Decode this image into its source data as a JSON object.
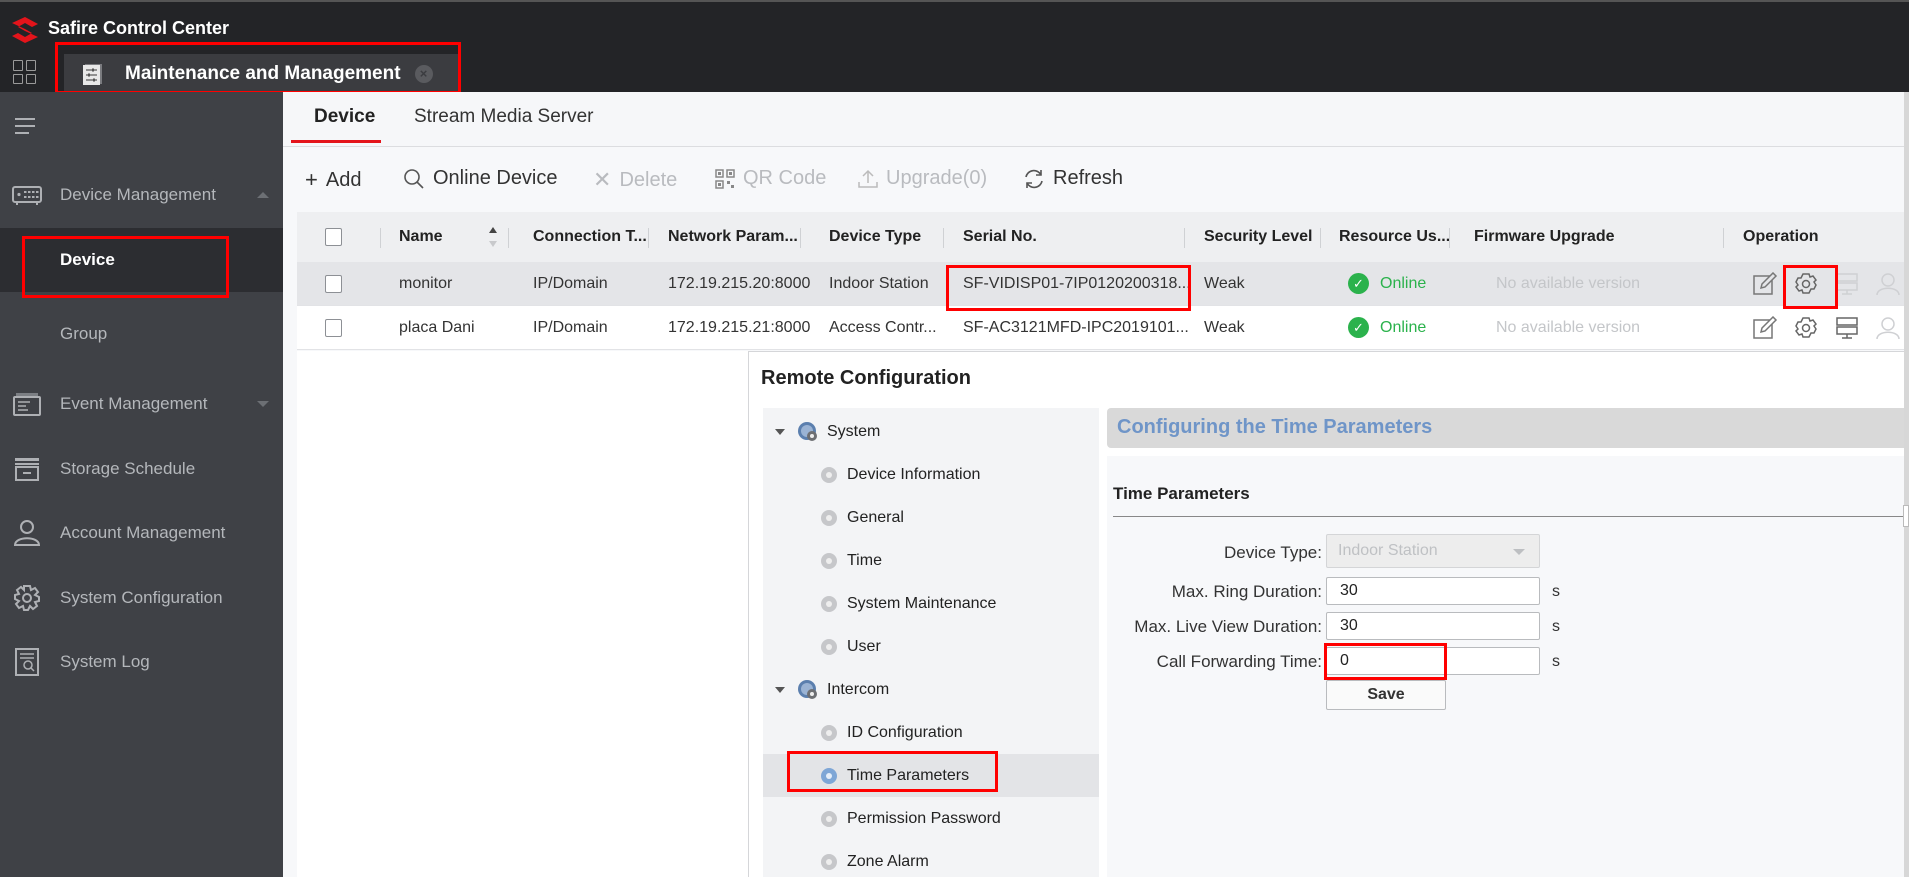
{
  "app": {
    "title": "Safire Control Center",
    "logo_icon": "safire-logo-icon",
    "brand_color": "#e4141b"
  },
  "app_tab": {
    "label": "Maintenance and Management",
    "icon": "sliders-icon",
    "close_icon": "close-circle-icon"
  },
  "sidebar": {
    "toggle_icon": "hamburger-icon",
    "groups": [
      {
        "label": "Device Management",
        "icon": "device-box-icon",
        "expanded": true,
        "children": [
          {
            "label": "Device",
            "active": true
          },
          {
            "label": "Group",
            "active": false
          }
        ]
      },
      {
        "label": "Event Management",
        "icon": "event-list-icon",
        "expanded": false
      },
      {
        "label": "Storage Schedule",
        "icon": "storage-icon"
      },
      {
        "label": "Account Management",
        "icon": "user-icon"
      },
      {
        "label": "System Configuration",
        "icon": "gear-icon"
      },
      {
        "label": "System Log",
        "icon": "log-search-icon"
      }
    ]
  },
  "subtabs": [
    {
      "label": "Device",
      "active": true
    },
    {
      "label": "Stream Media Server",
      "active": false
    }
  ],
  "toolbar": {
    "add": "Add",
    "online_device": "Online Device",
    "delete": "Delete",
    "qr_code": "QR Code",
    "upgrade": "Upgrade(0)",
    "refresh": "Refresh"
  },
  "table": {
    "columns": [
      "Name",
      "Connection T...",
      "Network Param...",
      "Device Type",
      "Serial No.",
      "Security Level",
      "Resource Us...",
      "Firmware Upgrade",
      "Operation"
    ],
    "rows": [
      {
        "name": "monitor",
        "connection": "IP/Domain",
        "network": "172.19.215.20:8000",
        "device_type": "Indoor Station",
        "serial": "SF-VIDISP01-7IP0120200318...",
        "security": "Weak",
        "status": "Online",
        "firmware": "No available version",
        "selected": true
      },
      {
        "name": "placa Dani",
        "connection": "IP/Domain",
        "network": "172.19.215.21:8000",
        "device_type": "Access Contr...",
        "serial": "SF-AC3121MFD-IPC2019101...",
        "security": "Weak",
        "status": "Online",
        "firmware": "No available version",
        "selected": false
      }
    ],
    "operation_icons": [
      "edit-icon",
      "settings-gear-icon",
      "server-icon",
      "user-outline-icon"
    ],
    "status_color": "#2bb24c"
  },
  "remote_config": {
    "title": "Remote Configuration",
    "tree": [
      {
        "label": "System",
        "type": "parent",
        "expanded": true
      },
      {
        "label": "Device Information",
        "type": "child"
      },
      {
        "label": "General",
        "type": "child"
      },
      {
        "label": "Time",
        "type": "child"
      },
      {
        "label": "System Maintenance",
        "type": "child"
      },
      {
        "label": "User",
        "type": "child"
      },
      {
        "label": "Intercom",
        "type": "parent",
        "expanded": true
      },
      {
        "label": "ID Configuration",
        "type": "child"
      },
      {
        "label": "Time Parameters",
        "type": "child",
        "selected": true
      },
      {
        "label": "Permission Password",
        "type": "child"
      },
      {
        "label": "Zone Alarm",
        "type": "child"
      }
    ],
    "panel_header": "Configuring the Time Parameters",
    "section_title": "Time Parameters",
    "fields": {
      "device_type": {
        "label": "Device Type:",
        "value": "Indoor Station"
      },
      "max_ring": {
        "label": "Max. Ring Duration:",
        "value": "30",
        "unit": "s"
      },
      "max_live_view": {
        "label": "Max. Live View Duration:",
        "value": "30",
        "unit": "s"
      },
      "call_forwarding": {
        "label": "Call Forwarding Time:",
        "value": "0",
        "unit": "s"
      }
    },
    "save_label": "Save",
    "header_text_color": "#6f95c8"
  }
}
